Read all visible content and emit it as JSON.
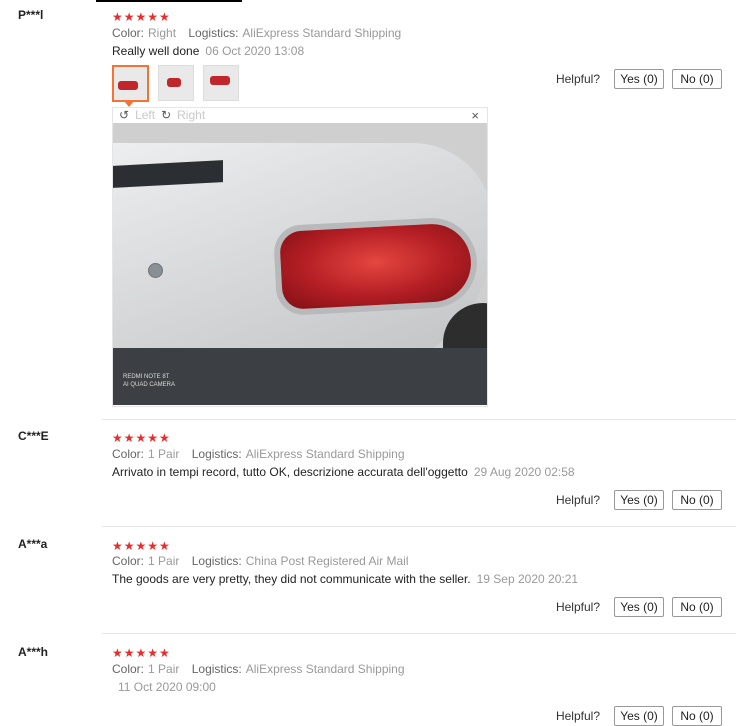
{
  "reviews": [
    {
      "name": "P***l",
      "stars": "★★★★★",
      "color_label": "Color:",
      "color_value": "Right",
      "logistics_label": "Logistics:",
      "logistics_value": "AliExpress Standard Shipping",
      "text": "Really well done",
      "date": "06 Oct 2020 13:08",
      "helpful_label": "Helpful?",
      "yes": "Yes (0)",
      "no": "No (0)"
    },
    {
      "name": "C***E",
      "stars": "★★★★★",
      "color_label": "Color:",
      "color_value": "1 Pair",
      "logistics_label": "Logistics:",
      "logistics_value": "AliExpress Standard Shipping",
      "text": "Arrivato in tempi record, tutto OK, descrizione accurata dell'oggetto",
      "date": "29 Aug 2020 02:58",
      "helpful_label": "Helpful?",
      "yes": "Yes (0)",
      "no": "No (0)"
    },
    {
      "name": "A***a",
      "stars": "★★★★★",
      "color_label": "Color:",
      "color_value": "1 Pair",
      "logistics_label": "Logistics:",
      "logistics_value": "China Post Registered Air Mail",
      "text": "The goods are very pretty, they did not communicate with the seller.",
      "date": "19 Sep 2020 20:21",
      "helpful_label": "Helpful?",
      "yes": "Yes (0)",
      "no": "No (0)"
    },
    {
      "name": "A***h",
      "stars": "★★★★★",
      "color_label": "Color:",
      "color_value": "1 Pair",
      "logistics_label": "Logistics:",
      "logistics_value": "AliExpress Standard Shipping",
      "text": "",
      "date": "11 Oct 2020 09:00",
      "helpful_label": "Helpful?",
      "yes": "Yes (0)",
      "no": "No (0)"
    }
  ],
  "viewer": {
    "rotate_left": "Left",
    "rotate_right": "Right",
    "close": "×",
    "watermark_line1": "REDMI NOTE 8T",
    "watermark_line2": "AI QUAD CAMERA"
  },
  "colors": {
    "stars": "#e62e2e",
    "active_thumb": "#f37335"
  }
}
